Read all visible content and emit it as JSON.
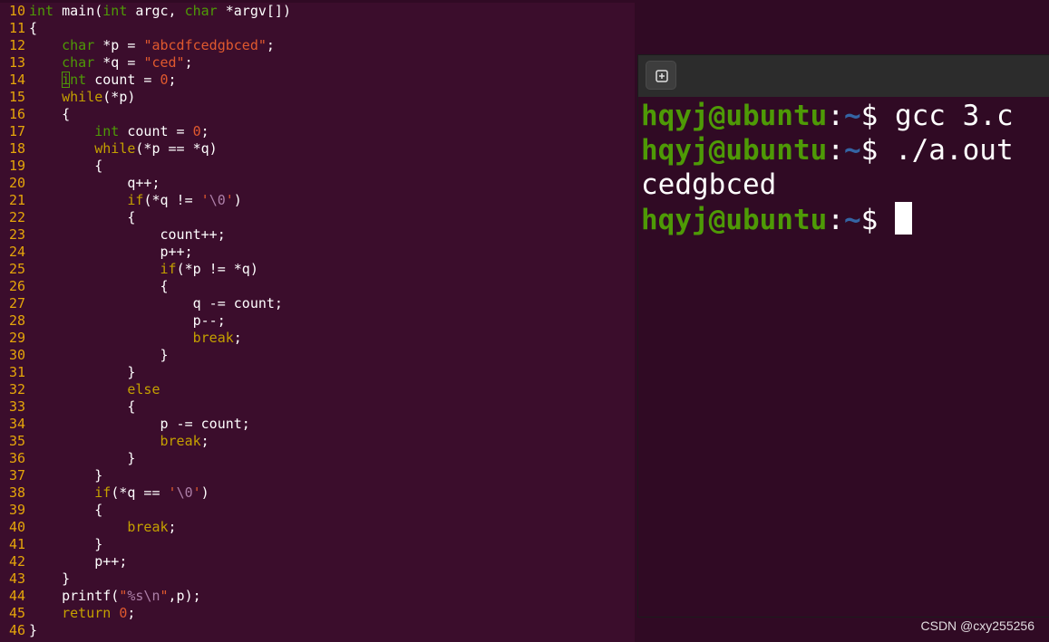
{
  "editor": {
    "lines": [
      {
        "n": "10",
        "tokens": [
          [
            "int",
            "type"
          ],
          [
            " main(",
            "plain"
          ],
          [
            "int",
            "type"
          ],
          [
            " argc, ",
            "plain"
          ],
          [
            "char",
            "type"
          ],
          [
            " *argv[])",
            "plain"
          ]
        ]
      },
      {
        "n": "11",
        "tokens": [
          [
            "{",
            "plain"
          ]
        ]
      },
      {
        "n": "12",
        "tokens": [
          [
            "    ",
            "plain"
          ],
          [
            "char",
            "type"
          ],
          [
            " *p = ",
            "plain"
          ],
          [
            "\"abcdfcedgbced\"",
            "str"
          ],
          [
            ";",
            "plain"
          ]
        ]
      },
      {
        "n": "13",
        "tokens": [
          [
            "    ",
            "plain"
          ],
          [
            "char",
            "type"
          ],
          [
            " *q = ",
            "plain"
          ],
          [
            "\"ced\"",
            "str"
          ],
          [
            ";",
            "plain"
          ]
        ]
      },
      {
        "n": "14",
        "tokens": [
          [
            "    ",
            "plain"
          ],
          [
            "i",
            "cursor-type"
          ],
          [
            "nt",
            "type"
          ],
          [
            " count = ",
            "plain"
          ],
          [
            "0",
            "num"
          ],
          [
            ";",
            "plain"
          ]
        ]
      },
      {
        "n": "15",
        "tokens": [
          [
            "    ",
            "plain"
          ],
          [
            "while",
            "kw"
          ],
          [
            "(*p)",
            "plain"
          ]
        ]
      },
      {
        "n": "16",
        "tokens": [
          [
            "    {",
            "plain"
          ]
        ]
      },
      {
        "n": "17",
        "tokens": [
          [
            "        ",
            "plain"
          ],
          [
            "int",
            "type"
          ],
          [
            " count = ",
            "plain"
          ],
          [
            "0",
            "num"
          ],
          [
            ";",
            "plain"
          ]
        ]
      },
      {
        "n": "18",
        "tokens": [
          [
            "        ",
            "plain"
          ],
          [
            "while",
            "kw"
          ],
          [
            "(*p == *q)",
            "plain"
          ]
        ]
      },
      {
        "n": "19",
        "tokens": [
          [
            "        {",
            "plain"
          ]
        ]
      },
      {
        "n": "20",
        "tokens": [
          [
            "            q++;",
            "plain"
          ]
        ]
      },
      {
        "n": "21",
        "tokens": [
          [
            "            ",
            "plain"
          ],
          [
            "if",
            "kw"
          ],
          [
            "(*q != ",
            "plain"
          ],
          [
            "'",
            "str"
          ],
          [
            "\\0",
            "esc"
          ],
          [
            "'",
            "str"
          ],
          [
            ")",
            "plain"
          ]
        ]
      },
      {
        "n": "22",
        "tokens": [
          [
            "            {",
            "plain"
          ]
        ]
      },
      {
        "n": "23",
        "tokens": [
          [
            "                count++;",
            "plain"
          ]
        ]
      },
      {
        "n": "24",
        "tokens": [
          [
            "                p++;",
            "plain"
          ]
        ]
      },
      {
        "n": "25",
        "tokens": [
          [
            "                ",
            "plain"
          ],
          [
            "if",
            "kw"
          ],
          [
            "(*p != *q)",
            "plain"
          ]
        ]
      },
      {
        "n": "26",
        "tokens": [
          [
            "                {",
            "plain"
          ]
        ]
      },
      {
        "n": "27",
        "tokens": [
          [
            "                    q -= count;",
            "plain"
          ]
        ]
      },
      {
        "n": "28",
        "tokens": [
          [
            "                    p--;",
            "plain"
          ]
        ]
      },
      {
        "n": "29",
        "tokens": [
          [
            "                    ",
            "plain"
          ],
          [
            "break",
            "kw"
          ],
          [
            ";",
            "plain"
          ]
        ]
      },
      {
        "n": "30",
        "tokens": [
          [
            "                }",
            "plain"
          ]
        ]
      },
      {
        "n": "31",
        "tokens": [
          [
            "            }",
            "plain"
          ]
        ]
      },
      {
        "n": "32",
        "tokens": [
          [
            "            ",
            "plain"
          ],
          [
            "else",
            "kw"
          ]
        ]
      },
      {
        "n": "33",
        "tokens": [
          [
            "            {",
            "plain"
          ]
        ]
      },
      {
        "n": "34",
        "tokens": [
          [
            "                p -= count;",
            "plain"
          ]
        ]
      },
      {
        "n": "35",
        "tokens": [
          [
            "                ",
            "plain"
          ],
          [
            "break",
            "kw"
          ],
          [
            ";",
            "plain"
          ]
        ]
      },
      {
        "n": "36",
        "tokens": [
          [
            "            }",
            "plain"
          ]
        ]
      },
      {
        "n": "37",
        "tokens": [
          [
            "        }",
            "plain"
          ]
        ]
      },
      {
        "n": "38",
        "tokens": [
          [
            "        ",
            "plain"
          ],
          [
            "if",
            "kw"
          ],
          [
            "(*q == ",
            "plain"
          ],
          [
            "'",
            "str"
          ],
          [
            "\\0",
            "esc"
          ],
          [
            "'",
            "str"
          ],
          [
            ")",
            "plain"
          ]
        ]
      },
      {
        "n": "39",
        "tokens": [
          [
            "        {",
            "plain"
          ]
        ]
      },
      {
        "n": "40",
        "tokens": [
          [
            "            ",
            "plain"
          ],
          [
            "break",
            "kw"
          ],
          [
            ";",
            "plain"
          ]
        ]
      },
      {
        "n": "41",
        "tokens": [
          [
            "        }",
            "plain"
          ]
        ]
      },
      {
        "n": "42",
        "tokens": [
          [
            "        p++;",
            "plain"
          ]
        ]
      },
      {
        "n": "43",
        "tokens": [
          [
            "    }",
            "plain"
          ]
        ]
      },
      {
        "n": "44",
        "tokens": [
          [
            "    printf(",
            "plain"
          ],
          [
            "\"",
            "str"
          ],
          [
            "%s\\n",
            "esc"
          ],
          [
            "\"",
            "str"
          ],
          [
            ",p);",
            "plain"
          ]
        ]
      },
      {
        "n": "45",
        "tokens": [
          [
            "    ",
            "plain"
          ],
          [
            "return",
            "kw"
          ],
          [
            " ",
            "plain"
          ],
          [
            "0",
            "num"
          ],
          [
            ";",
            "plain"
          ]
        ]
      },
      {
        "n": "46",
        "tokens": [
          [
            "}",
            "plain"
          ]
        ]
      }
    ]
  },
  "terminal": {
    "new_tab_icon": "new-tab-icon",
    "lines": [
      {
        "prompt": true,
        "user_host": "hqyj@ubuntu",
        "colon": ":",
        "path": "~",
        "dollar": "$ ",
        "command": "gcc 3.c"
      },
      {
        "prompt": true,
        "user_host": "hqyj@ubuntu",
        "colon": ":",
        "path": "~",
        "dollar": "$ ",
        "command": "./a.out"
      },
      {
        "prompt": false,
        "output": "cedgbced"
      },
      {
        "prompt": true,
        "user_host": "hqyj@ubuntu",
        "colon": ":",
        "path": "~",
        "dollar": "$ ",
        "command": "",
        "cursor": true
      }
    ]
  },
  "watermark": "CSDN @cxy255256",
  "colors": {
    "terminal_bg": "#300a24",
    "editor_bg": "#3b0d2c",
    "prompt_user": "#4e9a06",
    "prompt_path": "#3465a4",
    "line_number": "#e5a50a",
    "keyword": "#c4a000",
    "type": "#4e9a06",
    "string": "#e0592e",
    "escape": "#ad7fa8"
  }
}
